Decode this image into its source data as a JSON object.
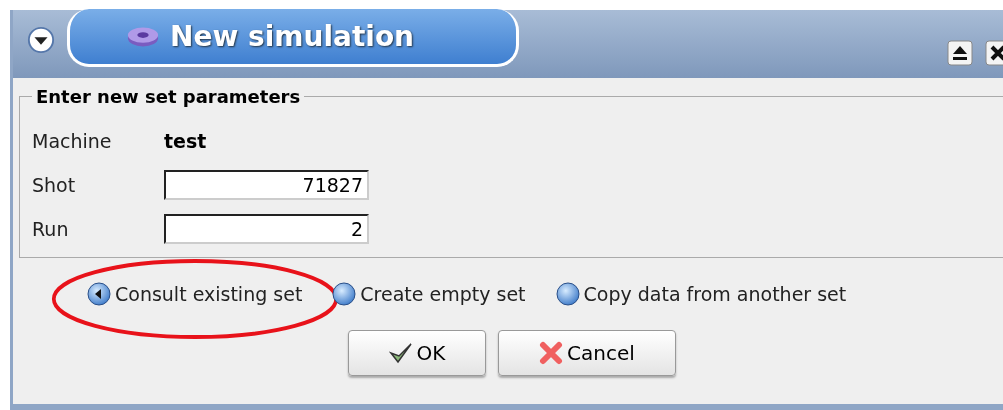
{
  "window": {
    "title": "New simulation"
  },
  "group": {
    "title": "Enter new set parameters",
    "fields": [
      {
        "kind": "static",
        "label": "Machine",
        "value": "test"
      },
      {
        "kind": "input",
        "label": "Shot",
        "value": "71827"
      },
      {
        "kind": "input",
        "label": "Run",
        "value": "2"
      }
    ]
  },
  "options": [
    {
      "label": "Consult existing set",
      "selected": true,
      "highlighted": true
    },
    {
      "label": "Create empty set",
      "selected": false,
      "highlighted": false
    },
    {
      "label": "Copy data from another set",
      "selected": false,
      "highlighted": false
    }
  ],
  "buttons": [
    {
      "kind": "ok",
      "label": "OK"
    },
    {
      "kind": "cancel",
      "label": "Cancel"
    }
  ]
}
